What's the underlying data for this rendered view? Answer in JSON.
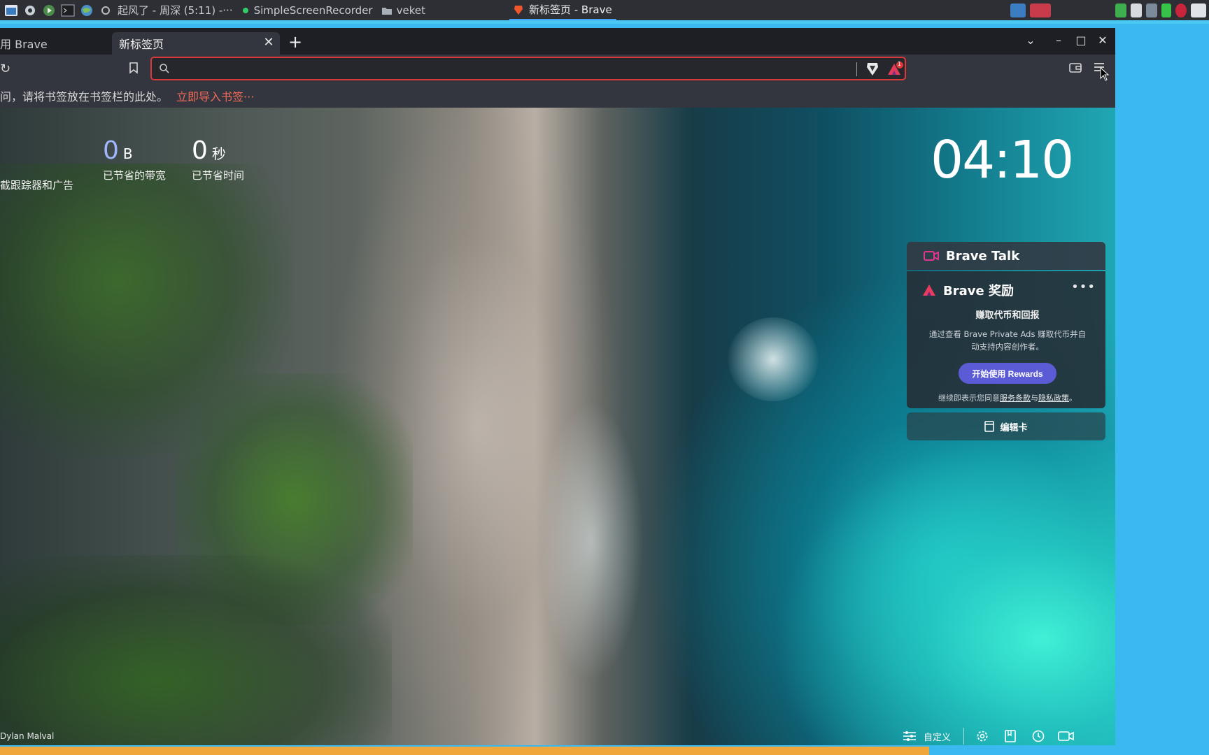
{
  "taskbar": {
    "tasks": [
      {
        "label": "起风了 - 周深 (5:11) -···",
        "active": false
      },
      {
        "label": "SimpleScreenRecorder",
        "active": false
      },
      {
        "label": "veket",
        "active": false
      },
      {
        "label": "新标签页 - Brave",
        "active": true
      }
    ]
  },
  "browser": {
    "tabs": [
      {
        "label": "用 Brave",
        "active": false
      },
      {
        "label": "新标签页",
        "active": true
      }
    ],
    "url_value": "",
    "bat_badge": "1",
    "bookmarks_bar": {
      "message": "问，请将书签放在书签栏的此处。",
      "import_link": "立即导入书签···"
    }
  },
  "ntp": {
    "stats": [
      {
        "value": "",
        "unit": "",
        "label": "截跟踪器和广告"
      },
      {
        "value": "0",
        "unit": "B",
        "label": "已节省的带宽"
      },
      {
        "value": "0",
        "unit": "秒",
        "label": "已节省时间"
      }
    ],
    "clock": "04:10",
    "brave_talk": {
      "title": "Brave Talk"
    },
    "rewards": {
      "title": "Brave 奖励",
      "subtitle": "赚取代币和回报",
      "description_line1": "通过查看 Brave Private Ads 赚取代币并自",
      "description_line2": "动支持内容创作者。",
      "button": "开始使用 Rewards",
      "terms_prefix": "继续即表示您同意",
      "terms_link": "服务条款",
      "terms_and": "与",
      "privacy_link": "隐私政策",
      "terms_suffix": "。"
    },
    "edit_cards": "编辑卡",
    "photo_credit": "Dylan Malval",
    "customize": "自定义"
  },
  "colors": {
    "accent_red": "#d83a3a",
    "link_red": "#f06a5a",
    "rewards_button": "#5b5bd6",
    "taskbar_bg": "#2d2f35"
  }
}
